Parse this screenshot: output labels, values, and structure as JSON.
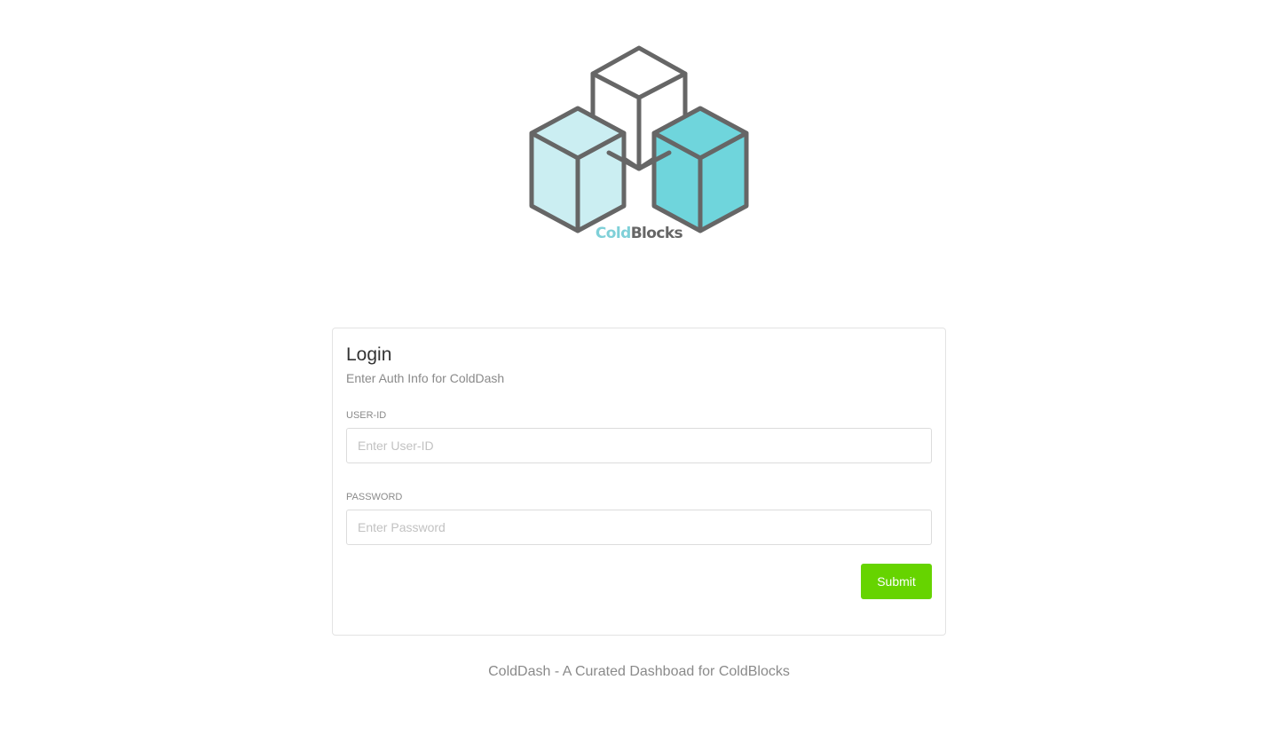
{
  "logo": {
    "text_part1": "Cold",
    "text_part2": "Blocks",
    "colors": {
      "outline": "#666666",
      "light_cube": "#cbeef2",
      "dark_cube": "#6fd5dc"
    }
  },
  "login": {
    "title": "Login",
    "subtitle": "Enter Auth Info for ColdDash",
    "user_label": "USER-ID",
    "user_placeholder": "Enter User-ID",
    "user_value": "",
    "password_label": "PASSWORD",
    "password_placeholder": "Enter Password",
    "password_value": "",
    "submit_label": "Submit"
  },
  "colors": {
    "accent": "#66d400",
    "muted_text": "#8a8a8a"
  },
  "footer": {
    "text": "ColdDash - A Curated Dashboad for ColdBlocks"
  }
}
